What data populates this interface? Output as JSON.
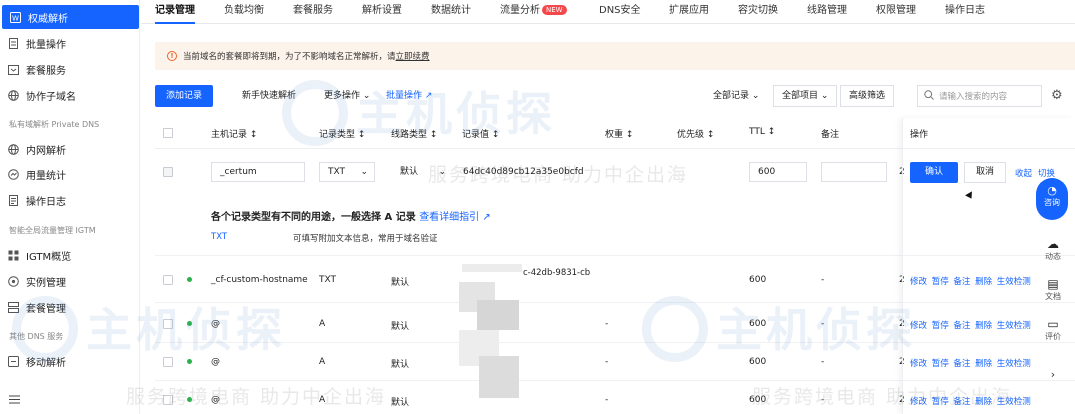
{
  "sidebar": {
    "items": [
      {
        "label": "权威解析",
        "icon": "dns-icon",
        "active": true
      },
      {
        "label": "批量操作",
        "icon": "batch-icon"
      },
      {
        "label": "套餐服务",
        "icon": "package-icon"
      },
      {
        "label": "协作子域名",
        "icon": "globe-icon"
      },
      {
        "label": "内网解析",
        "icon": "globe-icon"
      },
      {
        "label": "用量统计",
        "icon": "stats-icon"
      },
      {
        "label": "操作日志",
        "icon": "log-icon"
      },
      {
        "label": "IGTM概览",
        "icon": "grid-icon"
      },
      {
        "label": "实例管理",
        "icon": "instance-icon"
      },
      {
        "label": "套餐管理",
        "icon": "manage-icon"
      },
      {
        "label": "移动解析",
        "icon": "mobile-icon"
      }
    ],
    "groups": [
      "私有域解析 Private DNS",
      "智能全局流量管理 IGTM",
      "其他 DNS 服务"
    ]
  },
  "tabs": [
    {
      "label": "记录管理",
      "active": true
    },
    {
      "label": "负载均衡"
    },
    {
      "label": "套餐服务"
    },
    {
      "label": "解析设置"
    },
    {
      "label": "数据统计"
    },
    {
      "label": "流量分析",
      "badge": "NEW"
    },
    {
      "label": "DNS安全"
    },
    {
      "label": "扩展应用"
    },
    {
      "label": "容灾切换"
    },
    {
      "label": "线路管理"
    },
    {
      "label": "权限管理"
    },
    {
      "label": "操作日志"
    }
  ],
  "notice": {
    "text": "当前域名的套餐即将到期，为了不影响域名正常解析，请",
    "link": "立即续费"
  },
  "toolbar": {
    "add": "添加记录",
    "quick": "新手快速解析",
    "more": "更多操作",
    "batch": "批量操作",
    "all_records": "全部记录",
    "all_items": "全部项目",
    "advanced": "高级筛选",
    "search_placeholder": "请输入搜索的内容"
  },
  "columns": [
    "主机记录",
    "记录类型",
    "线路类型",
    "记录值",
    "权重",
    "优先级",
    "TTL",
    "备注",
    "操作"
  ],
  "edit_row": {
    "host": "_certum",
    "type": "TXT",
    "line": "默认",
    "value": "64dc40d89cb12a35e0bcfd",
    "ttl": "600",
    "confirm": "确认",
    "cancel": "取消",
    "collapse": "收起",
    "switch": "切换"
  },
  "tip": {
    "title": "各个记录类型有不同的用途，一般选择 A 记录",
    "link": "查看详细指引",
    "type": "TXT",
    "desc": "可填写附加文本信息，常用于域名验证"
  },
  "rows": [
    {
      "host": "_cf-custom-hostname",
      "type": "TXT",
      "line": "默认",
      "value": "c-42db-9831-cb",
      "dash": "",
      "ttl": "600",
      "remark": "-"
    },
    {
      "host": "@",
      "type": "A",
      "line": "默认",
      "value": "",
      "dash": "-",
      "ttl": "600",
      "remark": "-"
    },
    {
      "host": "@",
      "type": "A",
      "line": "默认",
      "value": "",
      "dash": "-",
      "ttl": "600",
      "remark": "-"
    },
    {
      "host": "@",
      "type": "A",
      "line": "默认",
      "value": "",
      "dash": "-",
      "ttl": "600",
      "remark": "-"
    }
  ],
  "row_ops": "修改 暂停 备注 删除 生效检测",
  "float": {
    "consult": "咨询",
    "dynamic": "动态",
    "docs": "文档",
    "review": "评价"
  },
  "watermark": {
    "title": "主机侦探",
    "sub": "服务跨境电商 助力中企出海"
  },
  "colors": {
    "primary": "#1664ff",
    "notice_bg": "#fcf3ea",
    "status_green": "#2bb24c",
    "badge_red": "#f5484a"
  }
}
